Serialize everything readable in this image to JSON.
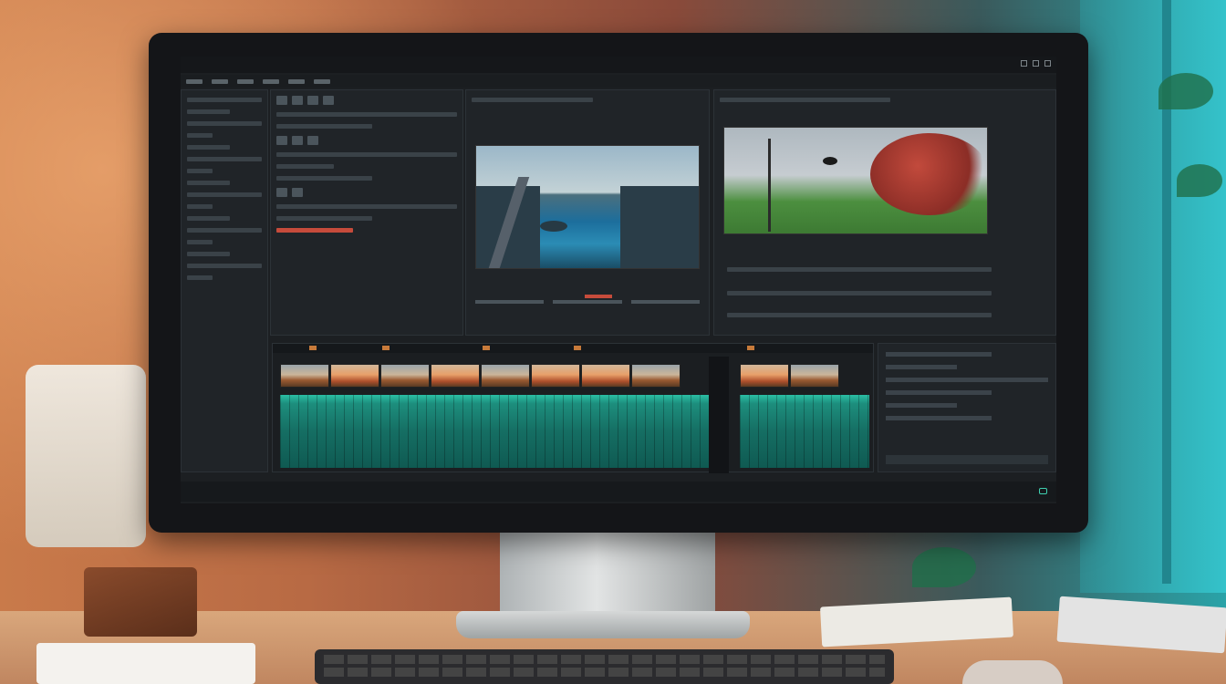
{
  "menu": {
    "items": [
      "",
      "",
      "",
      "",
      "",
      ""
    ]
  },
  "status": {
    "items": [
      "",
      "",
      "",
      ""
    ]
  },
  "colors": {
    "accent_teal": "#2bbfa4",
    "accent_orange": "#c77a3a",
    "playhead_red": "#c64b3b",
    "panel_bg": "#202428"
  },
  "icons": [
    "close-icon",
    "minimize-icon",
    "maximize-icon",
    "status-indicator-icon"
  ]
}
